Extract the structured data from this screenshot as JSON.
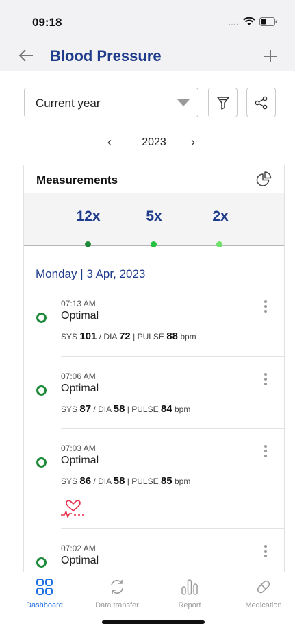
{
  "status_bar": {
    "time": "09:18"
  },
  "header": {
    "title": "Blood Pressure",
    "back_icon": "arrow-left-icon",
    "add_icon": "plus-icon"
  },
  "filters": {
    "period_value": "Current year",
    "filter_icon": "filter-icon",
    "share_icon": "share-icon"
  },
  "year_nav": {
    "prev": "‹",
    "year": "2023",
    "next": "›"
  },
  "measurements": {
    "title": "Measurements",
    "chart_icon": "pie-chart-icon",
    "counts": [
      {
        "label": "12x",
        "dot_color": "#1e8a3a"
      },
      {
        "label": "5x",
        "dot_color": "#23c23f"
      },
      {
        "label": "2x",
        "dot_color": "#6fe06a"
      }
    ],
    "day": "Monday | 3 Apr, 2023",
    "entries": [
      {
        "time": "07:13 AM",
        "status": "Optimal",
        "sys_label": "SYS",
        "sys": "101",
        "dia_label": "DIA",
        "dia": "72",
        "pulse_label": "PULSE",
        "pulse": "88",
        "unit": "bpm"
      },
      {
        "time": "07:06 AM",
        "status": "Optimal",
        "sys_label": "SYS",
        "sys": "87",
        "dia_label": "DIA",
        "dia": "58",
        "pulse_label": "PULSE",
        "pulse": "84",
        "unit": "bpm"
      },
      {
        "time": "07:03 AM",
        "status": "Optimal",
        "sys_label": "SYS",
        "sys": "86",
        "dia_label": "DIA",
        "dia": "58",
        "pulse_label": "PULSE",
        "pulse": "85",
        "unit": "bpm",
        "icon": "heart-rhythm-icon"
      },
      {
        "time": "07:02 AM",
        "status": "Optimal"
      }
    ]
  },
  "tabs": [
    {
      "label": "Dashboard",
      "icon": "dashboard-icon",
      "active": true
    },
    {
      "label": "Data transfer",
      "icon": "sync-icon"
    },
    {
      "label": "Report",
      "icon": "report-icon"
    },
    {
      "label": "Medication",
      "icon": "pill-icon"
    }
  ],
  "colors": {
    "brand": "#1f3c8c",
    "active_tab": "#1e6fe0",
    "optimal": "#1e8a3a",
    "heart": "#e8304d"
  }
}
